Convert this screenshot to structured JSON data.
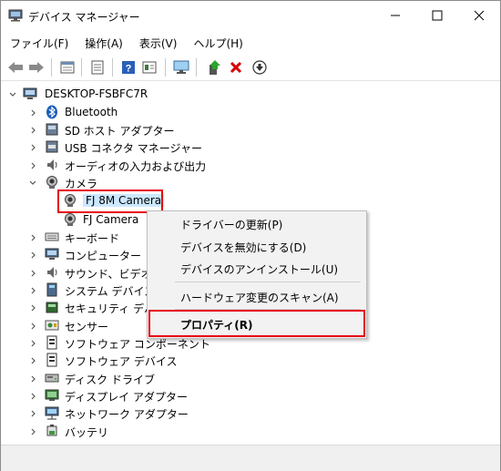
{
  "window": {
    "title": "デバイス マネージャー"
  },
  "menu": [
    "ファイル(F)",
    "操作(A)",
    "表示(V)",
    "ヘルプ(H)"
  ],
  "toolbar": {
    "icons": [
      "back-icon",
      "forward-icon",
      "properties-icon",
      "details-icon",
      "help-icon",
      "view-icon",
      "monitor-icon",
      "update-driver-icon",
      "uninstall-icon",
      "download-icon"
    ]
  },
  "tree": {
    "root": "DESKTOP-FSBFC7R",
    "items": [
      {
        "label": "Bluetooth",
        "icon": "bluetooth-icon"
      },
      {
        "label": "SD ホスト アダプター",
        "icon": "sd-host-icon"
      },
      {
        "label": "USB コネクタ マネージャー",
        "icon": "usb-icon"
      },
      {
        "label": "オーディオの入力および出力",
        "icon": "audio-icon"
      },
      {
        "label": "カメラ",
        "icon": "camera-icon",
        "expanded": true
      },
      {
        "label": "FJ 8M Camera",
        "icon": "camera-device-icon",
        "selected": true
      },
      {
        "label": "FJ Camera",
        "icon": "camera-device-icon"
      },
      {
        "label": "キーボード",
        "icon": "keyboard-icon"
      },
      {
        "label": "コンピューター",
        "icon": "computer-icon"
      },
      {
        "label": "サウンド、ビデオ、お",
        "icon": "sound-icon"
      },
      {
        "label": "システム デバイス",
        "icon": "system-icon"
      },
      {
        "label": "セキュリティ デバイ",
        "icon": "security-icon"
      },
      {
        "label": "センサー",
        "icon": "sensor-icon"
      },
      {
        "label": "ソフトウェア コンポーネント",
        "icon": "software-component-icon"
      },
      {
        "label": "ソフトウェア デバイス",
        "icon": "software-device-icon"
      },
      {
        "label": "ディスク ドライブ",
        "icon": "disk-icon"
      },
      {
        "label": "ディスプレイ アダプター",
        "icon": "display-icon"
      },
      {
        "label": "ネットワーク アダプター",
        "icon": "network-icon"
      },
      {
        "label": "バッテリ",
        "icon": "battery-icon"
      }
    ]
  },
  "context_menu": {
    "items": [
      "ドライバーの更新(P)",
      "デバイスを無効にする(D)",
      "デバイスのアンインストール(U)",
      "ハードウェア変更のスキャン(A)",
      "プロパティ(R)"
    ]
  },
  "colors": {
    "highlight_box": "#e60012",
    "menu_bg": "#f2f2f2"
  }
}
